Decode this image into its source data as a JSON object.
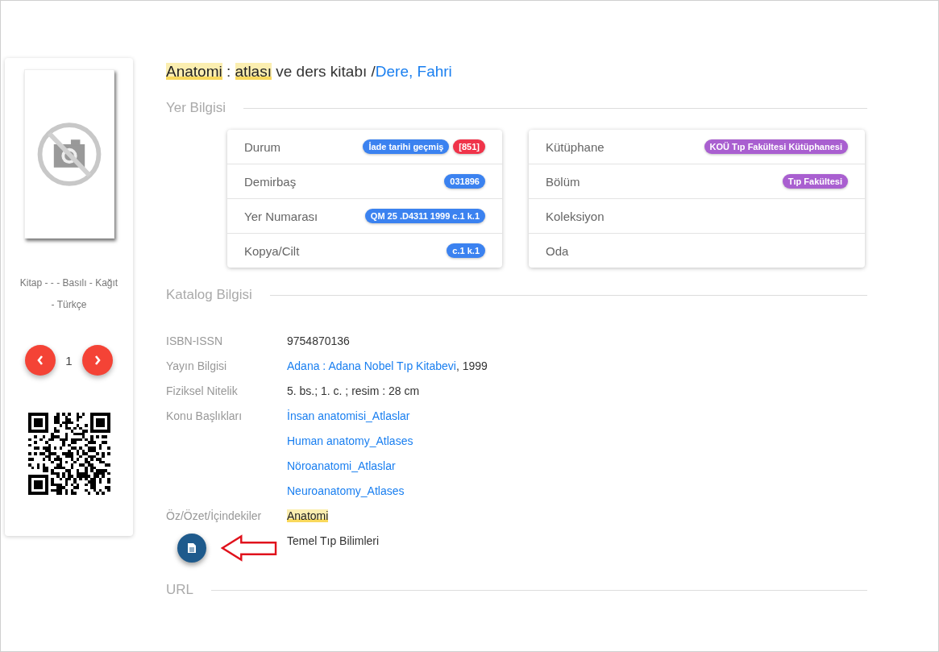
{
  "sidebar": {
    "format": "Kitap - - - Basılı - Kağıt - Türkçe",
    "page": "1"
  },
  "title": {
    "parts": [
      {
        "text": "Anatomi",
        "highlighted": true
      },
      {
        "text": " : ",
        "highlighted": false
      },
      {
        "text": "atlası",
        "highlighted": true
      },
      {
        "text": " ve ders kitabı / ",
        "highlighted": false
      }
    ],
    "author": "Dere, Fahri"
  },
  "location": {
    "heading": "Yer Bilgisi",
    "cards": [
      [
        {
          "label": "Durum",
          "badges": [
            {
              "text": "İade tarihi geçmiş",
              "color": "#3b82f0"
            },
            {
              "text": "[851]",
              "color": "#f0344a"
            }
          ]
        },
        {
          "label": "Demirbaş",
          "badges": [
            {
              "text": "031896",
              "color": "#3b82f0"
            }
          ]
        },
        {
          "label": "Yer Numarası",
          "badges": [
            {
              "text": "QM 25 .D4311 1999 c.1 k.1",
              "color": "#3b82f0"
            }
          ]
        },
        {
          "label": "Kopya/Cilt",
          "badges": [
            {
              "text": "c.1 k.1",
              "color": "#3b82f0"
            }
          ]
        }
      ],
      [
        {
          "label": "Kütüphane",
          "badges": [
            {
              "text": "KOÜ Tıp Fakültesi Kütüphanesi",
              "color": "#a95fd0"
            }
          ]
        },
        {
          "label": "Bölüm",
          "badges": [
            {
              "text": "Tıp Fakültesi",
              "color": "#a95fd0"
            }
          ]
        },
        {
          "label": "Koleksiyon"
        },
        {
          "label": "Oda"
        }
      ]
    ]
  },
  "catalog": {
    "heading": "Katalog Bilgisi",
    "rows": [
      {
        "label": "ISBN-ISSN",
        "values": [
          {
            "kind": "text",
            "text": "9754870136"
          }
        ]
      },
      {
        "label": "Yayın Bilgisi",
        "values": [
          {
            "kind": "link",
            "text": "Adana : Adana Nobel Tıp Kitabevi",
            "suffix": ", 1999"
          }
        ]
      },
      {
        "label": "Fiziksel Nitelik",
        "values": [
          {
            "kind": "text",
            "text": "5. bs.; 1. c. ; resim : 28 cm"
          }
        ]
      },
      {
        "label": "Konu Başlıkları",
        "values": [
          {
            "kind": "link",
            "text": "İnsan anatomisi_Atlaslar"
          },
          {
            "kind": "link",
            "text": "Human anatomy_Atlases"
          },
          {
            "kind": "link",
            "text": "Nöroanatomi_Atlaslar"
          },
          {
            "kind": "link",
            "text": "Neuroanatomy_Atlases"
          }
        ]
      },
      {
        "label": "Öz/Özet/İçindekiler",
        "values": [
          {
            "kind": "highlight",
            "text": "Anatomi"
          },
          {
            "kind": "text",
            "text": "Temel Tıp Bilimleri"
          }
        ]
      }
    ]
  },
  "url": {
    "heading": "URL"
  }
}
